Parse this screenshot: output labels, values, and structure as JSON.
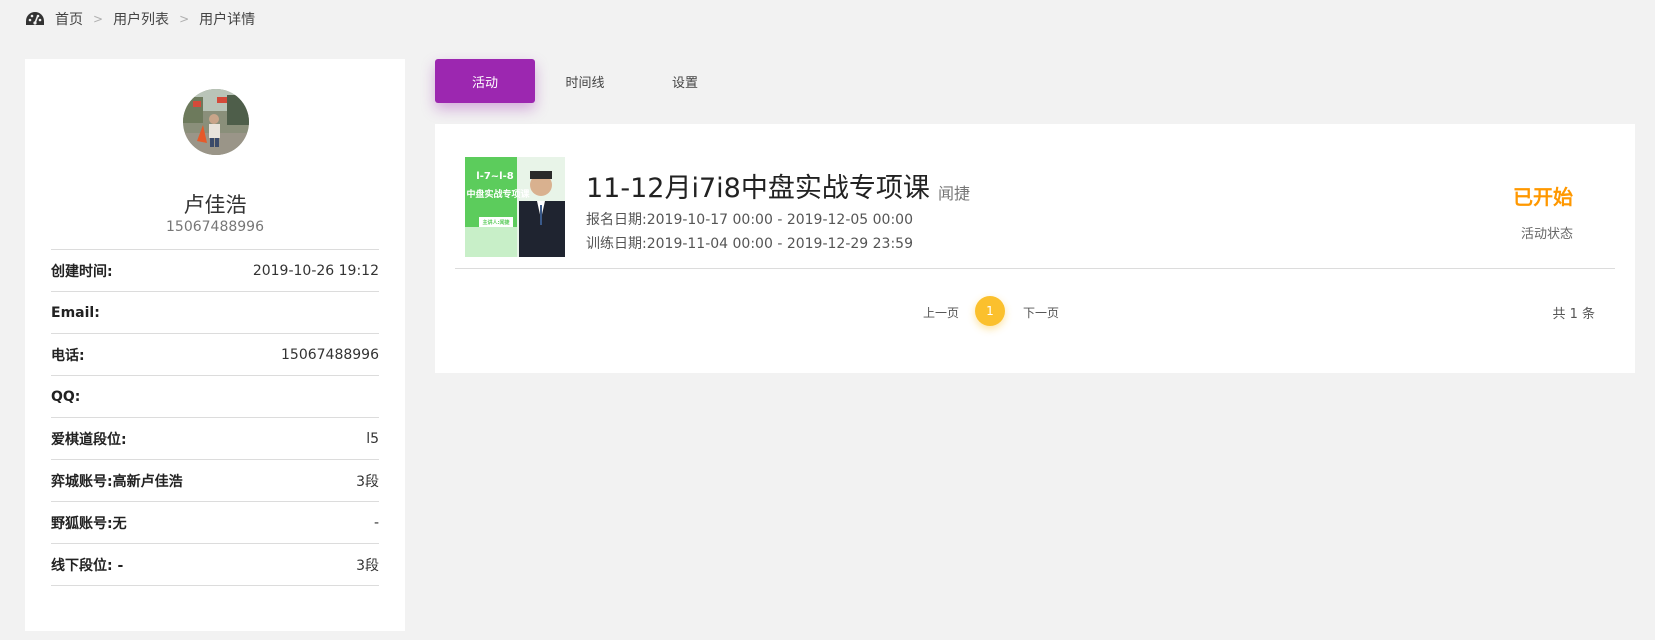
{
  "breadcrumb": {
    "items": [
      "首页",
      "用户列表",
      "用户详情"
    ],
    "separator": ">"
  },
  "profile": {
    "name": "卢佳浩",
    "phone": "15067488996",
    "details": [
      {
        "label": "创建时间:",
        "value": "2019-10-26 19:12"
      },
      {
        "label": "Email:",
        "value": ""
      },
      {
        "label": "电话:",
        "value": "15067488996"
      },
      {
        "label": "QQ:",
        "value": ""
      },
      {
        "label": "爱棋道段位:",
        "value": "l5"
      },
      {
        "label": "弈城账号:高新卢佳浩",
        "value": "3段"
      },
      {
        "label": "野狐账号:无",
        "value": "-"
      },
      {
        "label": "线下段位: -",
        "value": "3段"
      }
    ]
  },
  "tabs": [
    {
      "label": "活动",
      "active": true
    },
    {
      "label": "时间线",
      "active": false
    },
    {
      "label": "设置",
      "active": false
    }
  ],
  "activity": {
    "thumb_lines": [
      "l-7~l-8",
      "中盘实战专项课",
      "主讲人:闻捷"
    ],
    "title": "11-12月i7i8中盘实战专项课",
    "teacher": "闻捷",
    "registration": "报名日期:2019-10-17 00:00 - 2019-12-05 00:00",
    "training": "训练日期:2019-11-04 00:00 - 2019-12-29 23:59",
    "status": "已开始",
    "status_label": "活动状态"
  },
  "pagination": {
    "prev": "上一页",
    "current": "1",
    "next": "下一页",
    "total": "共 1 条"
  },
  "colors": {
    "accent": "#9c27b0",
    "status": "#ff9800",
    "page_active": "#fbc02d",
    "thumb_green": "#5ccc5c"
  },
  "icons": {
    "home": "dashboard-gauge-icon"
  }
}
